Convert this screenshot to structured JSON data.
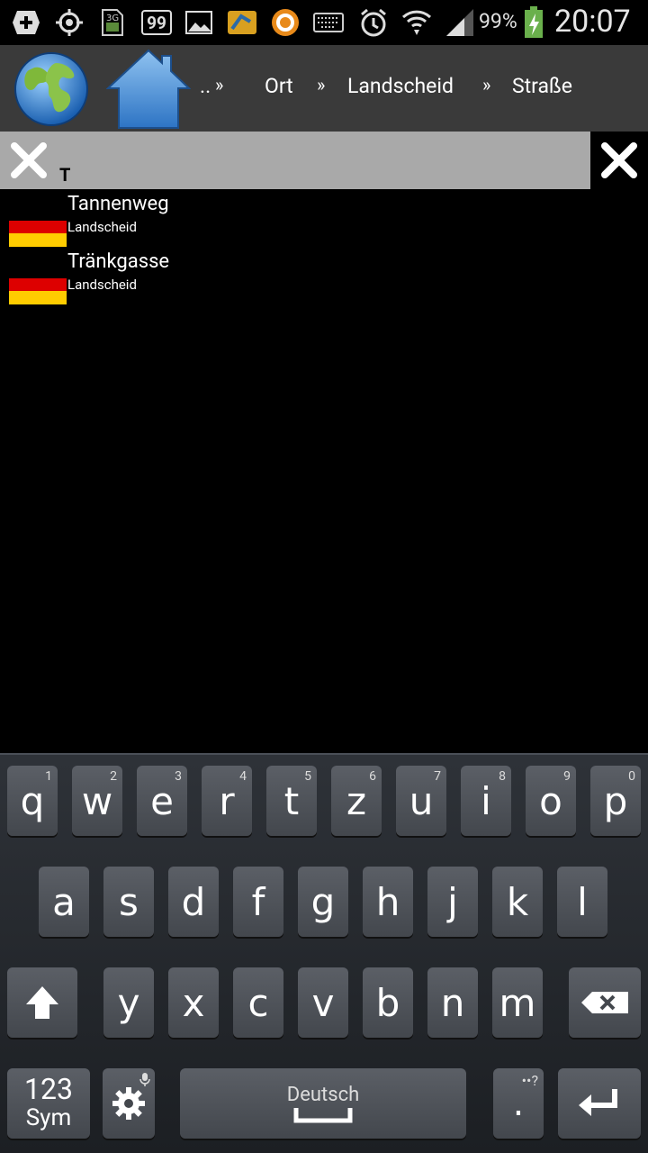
{
  "status_bar": {
    "icons": [
      "add-icon",
      "gps-icon",
      "3g-sim-icon",
      "notification-99-icon",
      "image-icon",
      "app-icon",
      "orange-ring-icon",
      "keyboard-icon",
      "alarm-icon",
      "wifi-icon",
      "signal-icon",
      "battery-charging-icon"
    ],
    "notif_count": "99",
    "battery": "99%",
    "time": "20:07"
  },
  "nav": {
    "globe_icon": "globe-icon",
    "home_icon": "home-icon",
    "crumbs": [
      "..",
      "Ort",
      "Landscheid",
      "Straße"
    ],
    "separator": "»"
  },
  "search": {
    "value": "T",
    "clear_icon": "close-icon"
  },
  "results": [
    {
      "name": "Tannenweg",
      "sub": "Landscheid",
      "flag_colors": [
        "#dd0000",
        "#ffcc00"
      ]
    },
    {
      "name": "Tränkgasse",
      "sub": "Landscheid",
      "flag_colors": [
        "#dd0000",
        "#ffcc00"
      ]
    }
  ],
  "keyboard": {
    "row1": [
      {
        "k": "q",
        "n": "1"
      },
      {
        "k": "w",
        "n": "2"
      },
      {
        "k": "e",
        "n": "3"
      },
      {
        "k": "r",
        "n": "4"
      },
      {
        "k": "t",
        "n": "5"
      },
      {
        "k": "z",
        "n": "6"
      },
      {
        "k": "u",
        "n": "7"
      },
      {
        "k": "i",
        "n": "8"
      },
      {
        "k": "o",
        "n": "9"
      },
      {
        "k": "p",
        "n": "0"
      }
    ],
    "row2": [
      "a",
      "s",
      "d",
      "f",
      "g",
      "h",
      "j",
      "k",
      "l"
    ],
    "row3": [
      "y",
      "x",
      "c",
      "v",
      "b",
      "n",
      "m"
    ],
    "sym_label_1": "123",
    "sym_label_2": "Sym",
    "space_label": "Deutsch",
    "period": ".",
    "period_extra": "••?"
  }
}
